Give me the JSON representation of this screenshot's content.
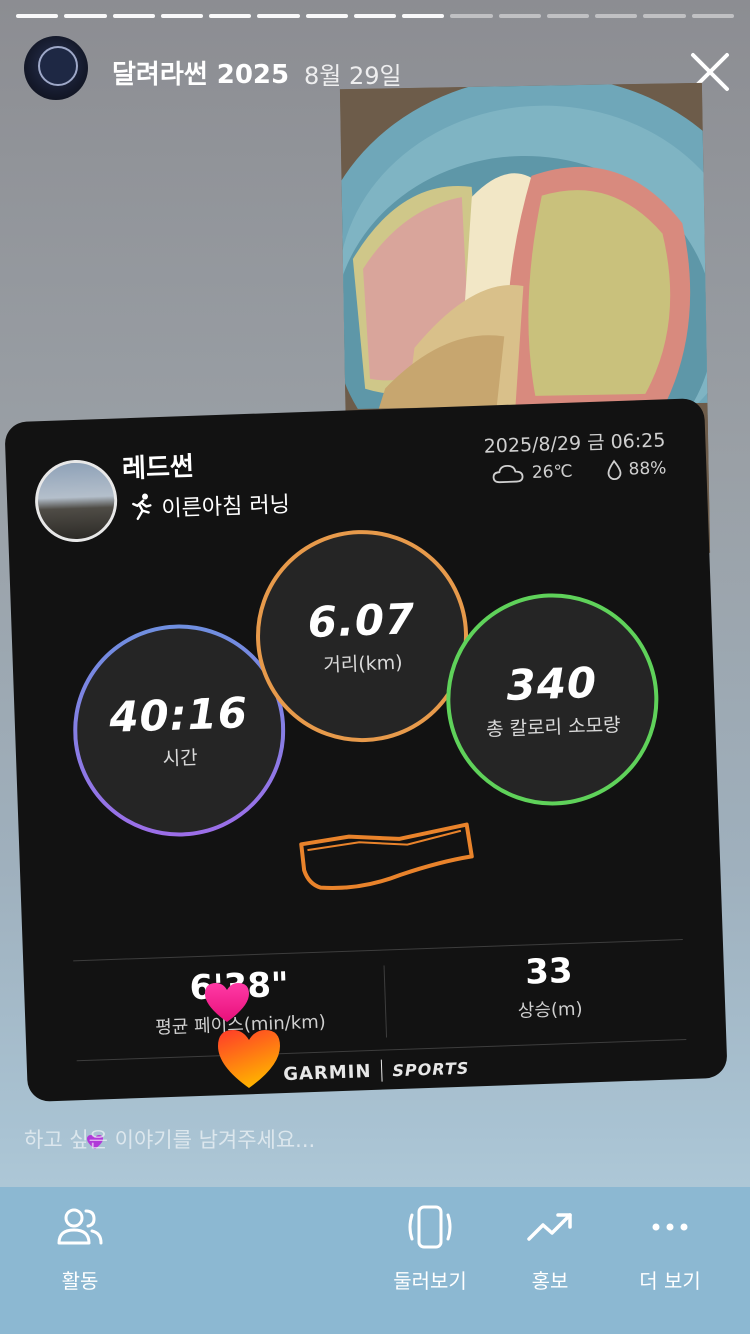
{
  "story": {
    "progress_segments": 15,
    "progress_done": 9,
    "title": "달려라썬 2025",
    "date": "8월 29일"
  },
  "card": {
    "name": "레드썬",
    "activity": "이른아침 러닝",
    "datetime": "2025/8/29 금 06:25",
    "temperature": "26℃",
    "humidity": "88%",
    "time_value": "40:16",
    "time_label": "시간",
    "distance_value": "6.07",
    "distance_label": "거리(km)",
    "calories_value": "340",
    "calories_label": "총 칼로리 소모량",
    "pace_value": "6'38\"",
    "pace_label": "평균 페이스(min/km)",
    "ascent_value": "33",
    "ascent_label": "상승(m)",
    "brand": "GARMIN",
    "brand_sub": "SPORTS"
  },
  "reply": {
    "placeholder": "하고 싶은 이야기를 남겨주세요..."
  },
  "nav": {
    "activity": "활동",
    "browse": "둘러보기",
    "promote": "홍보",
    "more": "더 보기"
  },
  "colors": {
    "time_ring": "#7e7fe6",
    "distance_ring": "#e79a4b",
    "calorie_ring": "#5fd25a",
    "bottom_bar": "#8cb8d2",
    "card_bg": "#121212"
  },
  "icons": {
    "close": "close-icon",
    "activity": "people-icon",
    "browse": "phone-rotate-icon",
    "promote": "trend-up-icon",
    "more": "more-dots-icon"
  }
}
